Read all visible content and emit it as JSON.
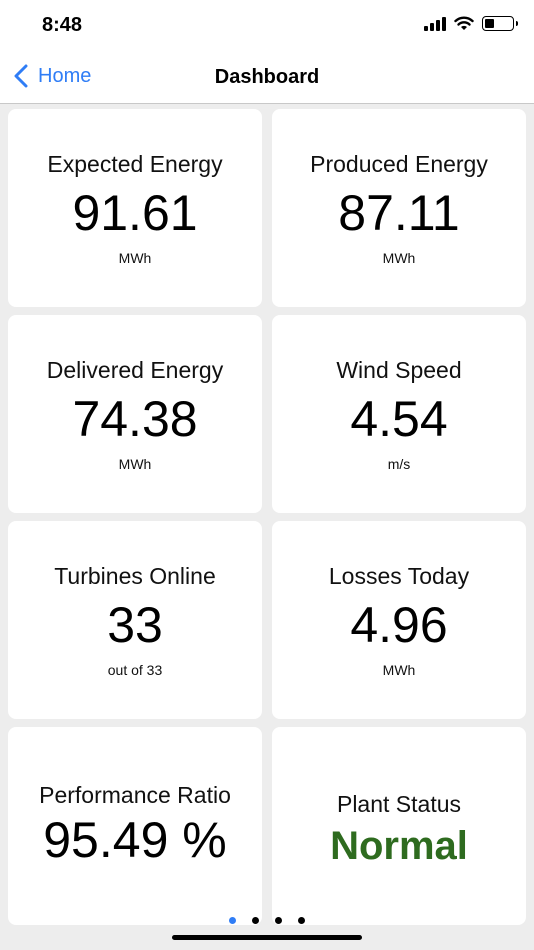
{
  "status_bar": {
    "time": "8:48"
  },
  "nav": {
    "back_label": "Home",
    "title": "Dashboard"
  },
  "cards": [
    {
      "title": "Expected Energy",
      "value": "91.61",
      "unit": "MWh"
    },
    {
      "title": "Produced Energy",
      "value": "87.11",
      "unit": "MWh"
    },
    {
      "title": "Delivered Energy",
      "value": "74.38",
      "unit": "MWh"
    },
    {
      "title": "Wind Speed",
      "value": "4.54",
      "unit": "m/s"
    },
    {
      "title": "Turbines Online",
      "value": "33",
      "unit": "out of 33"
    },
    {
      "title": "Losses Today",
      "value": "4.96",
      "unit": "MWh"
    },
    {
      "title": "Performance Ratio",
      "value": "95.49 %"
    },
    {
      "title": "Plant Status",
      "value": "Normal",
      "value_color": "#2e6b1f"
    }
  ],
  "pager": {
    "pages": 4,
    "active": 1
  },
  "colors": {
    "accent": "#2f7df6",
    "status_ok": "#2e6b1f"
  }
}
